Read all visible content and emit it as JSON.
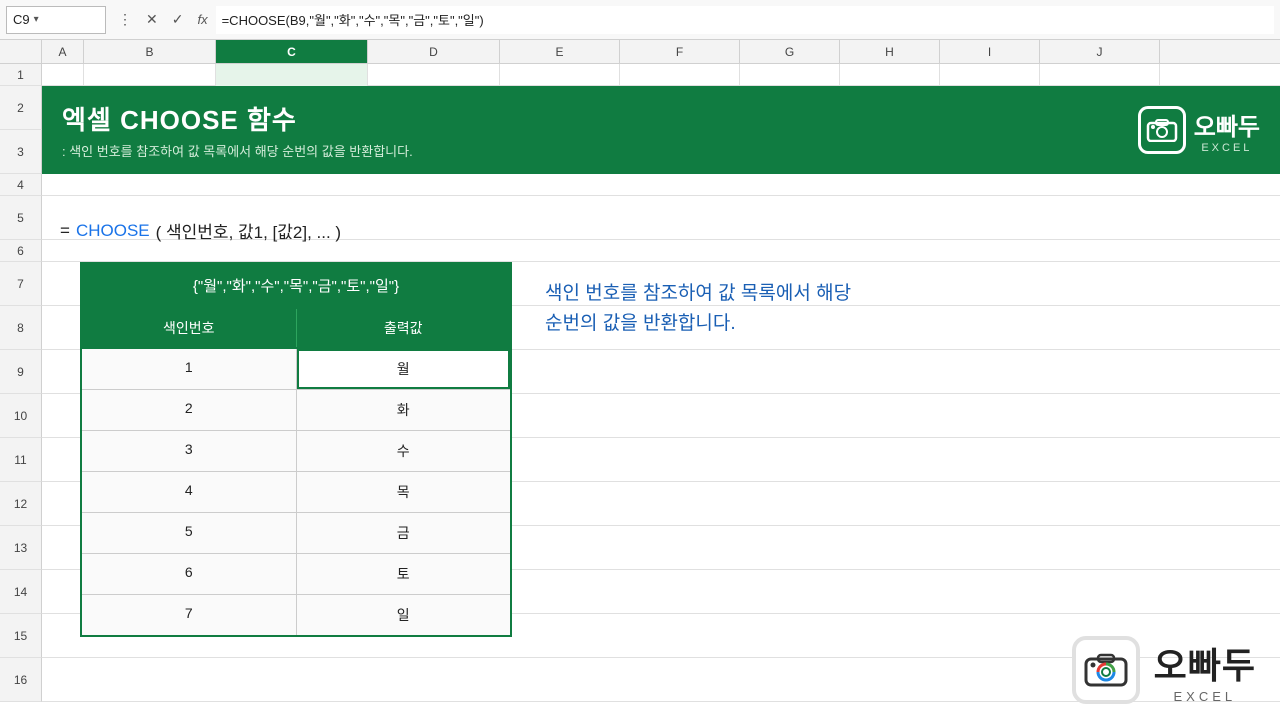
{
  "formula_bar": {
    "cell_ref": "C9",
    "formula": "=CHOOSE(B9,\"월\",\"화\",\"수\",\"목\",\"금\",\"토\",\"일\")"
  },
  "columns": [
    "A",
    "B",
    "C",
    "D",
    "E",
    "F",
    "G",
    "H",
    "I",
    "J"
  ],
  "banner": {
    "title": "엑셀 CHOOSE 함수",
    "subtitle": ": 색인 번호를 참조하여 값 목록에서 해당 순번의 값을 반환합니다.",
    "logo_brand": "오빠두",
    "logo_sub": "EXCEL"
  },
  "formula_syntax": {
    "equals": "=",
    "name": "CHOOSE",
    "args": "( 색인번호, 값1, [값2], ... )"
  },
  "table": {
    "top_header": "{\"월\",\"화\",\"수\",\"목\",\"금\",\"토\",\"일\"}",
    "col_index_label": "색인번호",
    "col_value_label": "출력값",
    "rows": [
      {
        "index": "1",
        "value": "월"
      },
      {
        "index": "2",
        "value": "화"
      },
      {
        "index": "3",
        "value": "수"
      },
      {
        "index": "4",
        "value": "목"
      },
      {
        "index": "5",
        "value": "금"
      },
      {
        "index": "6",
        "value": "토"
      },
      {
        "index": "7",
        "value": "일"
      }
    ],
    "active_row": 0
  },
  "description": {
    "line1": "색인 번호를 참조하여 값 목록에서 해당",
    "line2": "순번의 값을 반환합니다."
  },
  "row_numbers": [
    1,
    2,
    3,
    4,
    5,
    6,
    7,
    8,
    9,
    10,
    11,
    12,
    13,
    14,
    15,
    16
  ],
  "colors": {
    "green": "#107c41",
    "blue": "#1a73e8",
    "light_green_bg": "#e6f4ea"
  }
}
